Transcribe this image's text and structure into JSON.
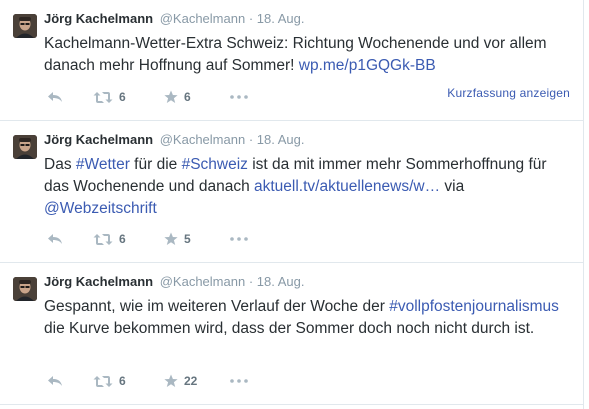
{
  "tweets": [
    {
      "fullname": "Jörg Kachelmann",
      "username": "@Kachelmann",
      "separator": "·",
      "time": "18. Aug.",
      "text_parts": [
        {
          "text": "Kachelmann-Wetter-Extra Schweiz: Richtung Wochenende und vor allem danach mehr Hoffnung auf Sommer! ",
          "link": false
        },
        {
          "text": "wp.me/p1GQGk-BB",
          "link": true
        }
      ],
      "retweet_count": "6",
      "favorite_count": "6",
      "summary_label": "Kurzfassung anzeigen"
    },
    {
      "fullname": "Jörg Kachelmann",
      "username": "@Kachelmann",
      "separator": "·",
      "time": "18. Aug.",
      "text_parts": [
        {
          "text": "Das ",
          "link": false
        },
        {
          "text": "#Wetter",
          "link": true
        },
        {
          "text": " für die ",
          "link": false
        },
        {
          "text": "#Schweiz",
          "link": true
        },
        {
          "text": " ist da mit immer mehr Sommerhoffnung für das Wochenende und danach ",
          "link": false
        },
        {
          "text": "aktuell.tv/aktuellenews/w…",
          "link": true
        },
        {
          "text": " via ",
          "link": false
        },
        {
          "text": "@Webzeitschrift",
          "link": true
        }
      ],
      "retweet_count": "6",
      "favorite_count": "5"
    },
    {
      "fullname": "Jörg Kachelmann",
      "username": "@Kachelmann",
      "separator": "·",
      "time": "18. Aug.",
      "text_parts": [
        {
          "text": "Gespannt, wie im weiteren Verlauf der Woche der ",
          "link": false
        },
        {
          "text": "#vollpfostenjournalismus",
          "link": true
        },
        {
          "text": " die Kurve bekommen wird, dass der Sommer doch noch nicht durch ist.",
          "link": false
        }
      ],
      "retweet_count": "6",
      "favorite_count": "22"
    }
  ],
  "icons": {
    "reply": "reply-arrow-icon",
    "retweet": "retweet-arrows-icon",
    "favorite": "star-icon",
    "more": "three-dots-icon"
  },
  "colors": {
    "link": "#3b5bb2",
    "secondary_text": "#8899a6",
    "icon": "#aab8c2",
    "divider": "#e1e8ed"
  }
}
